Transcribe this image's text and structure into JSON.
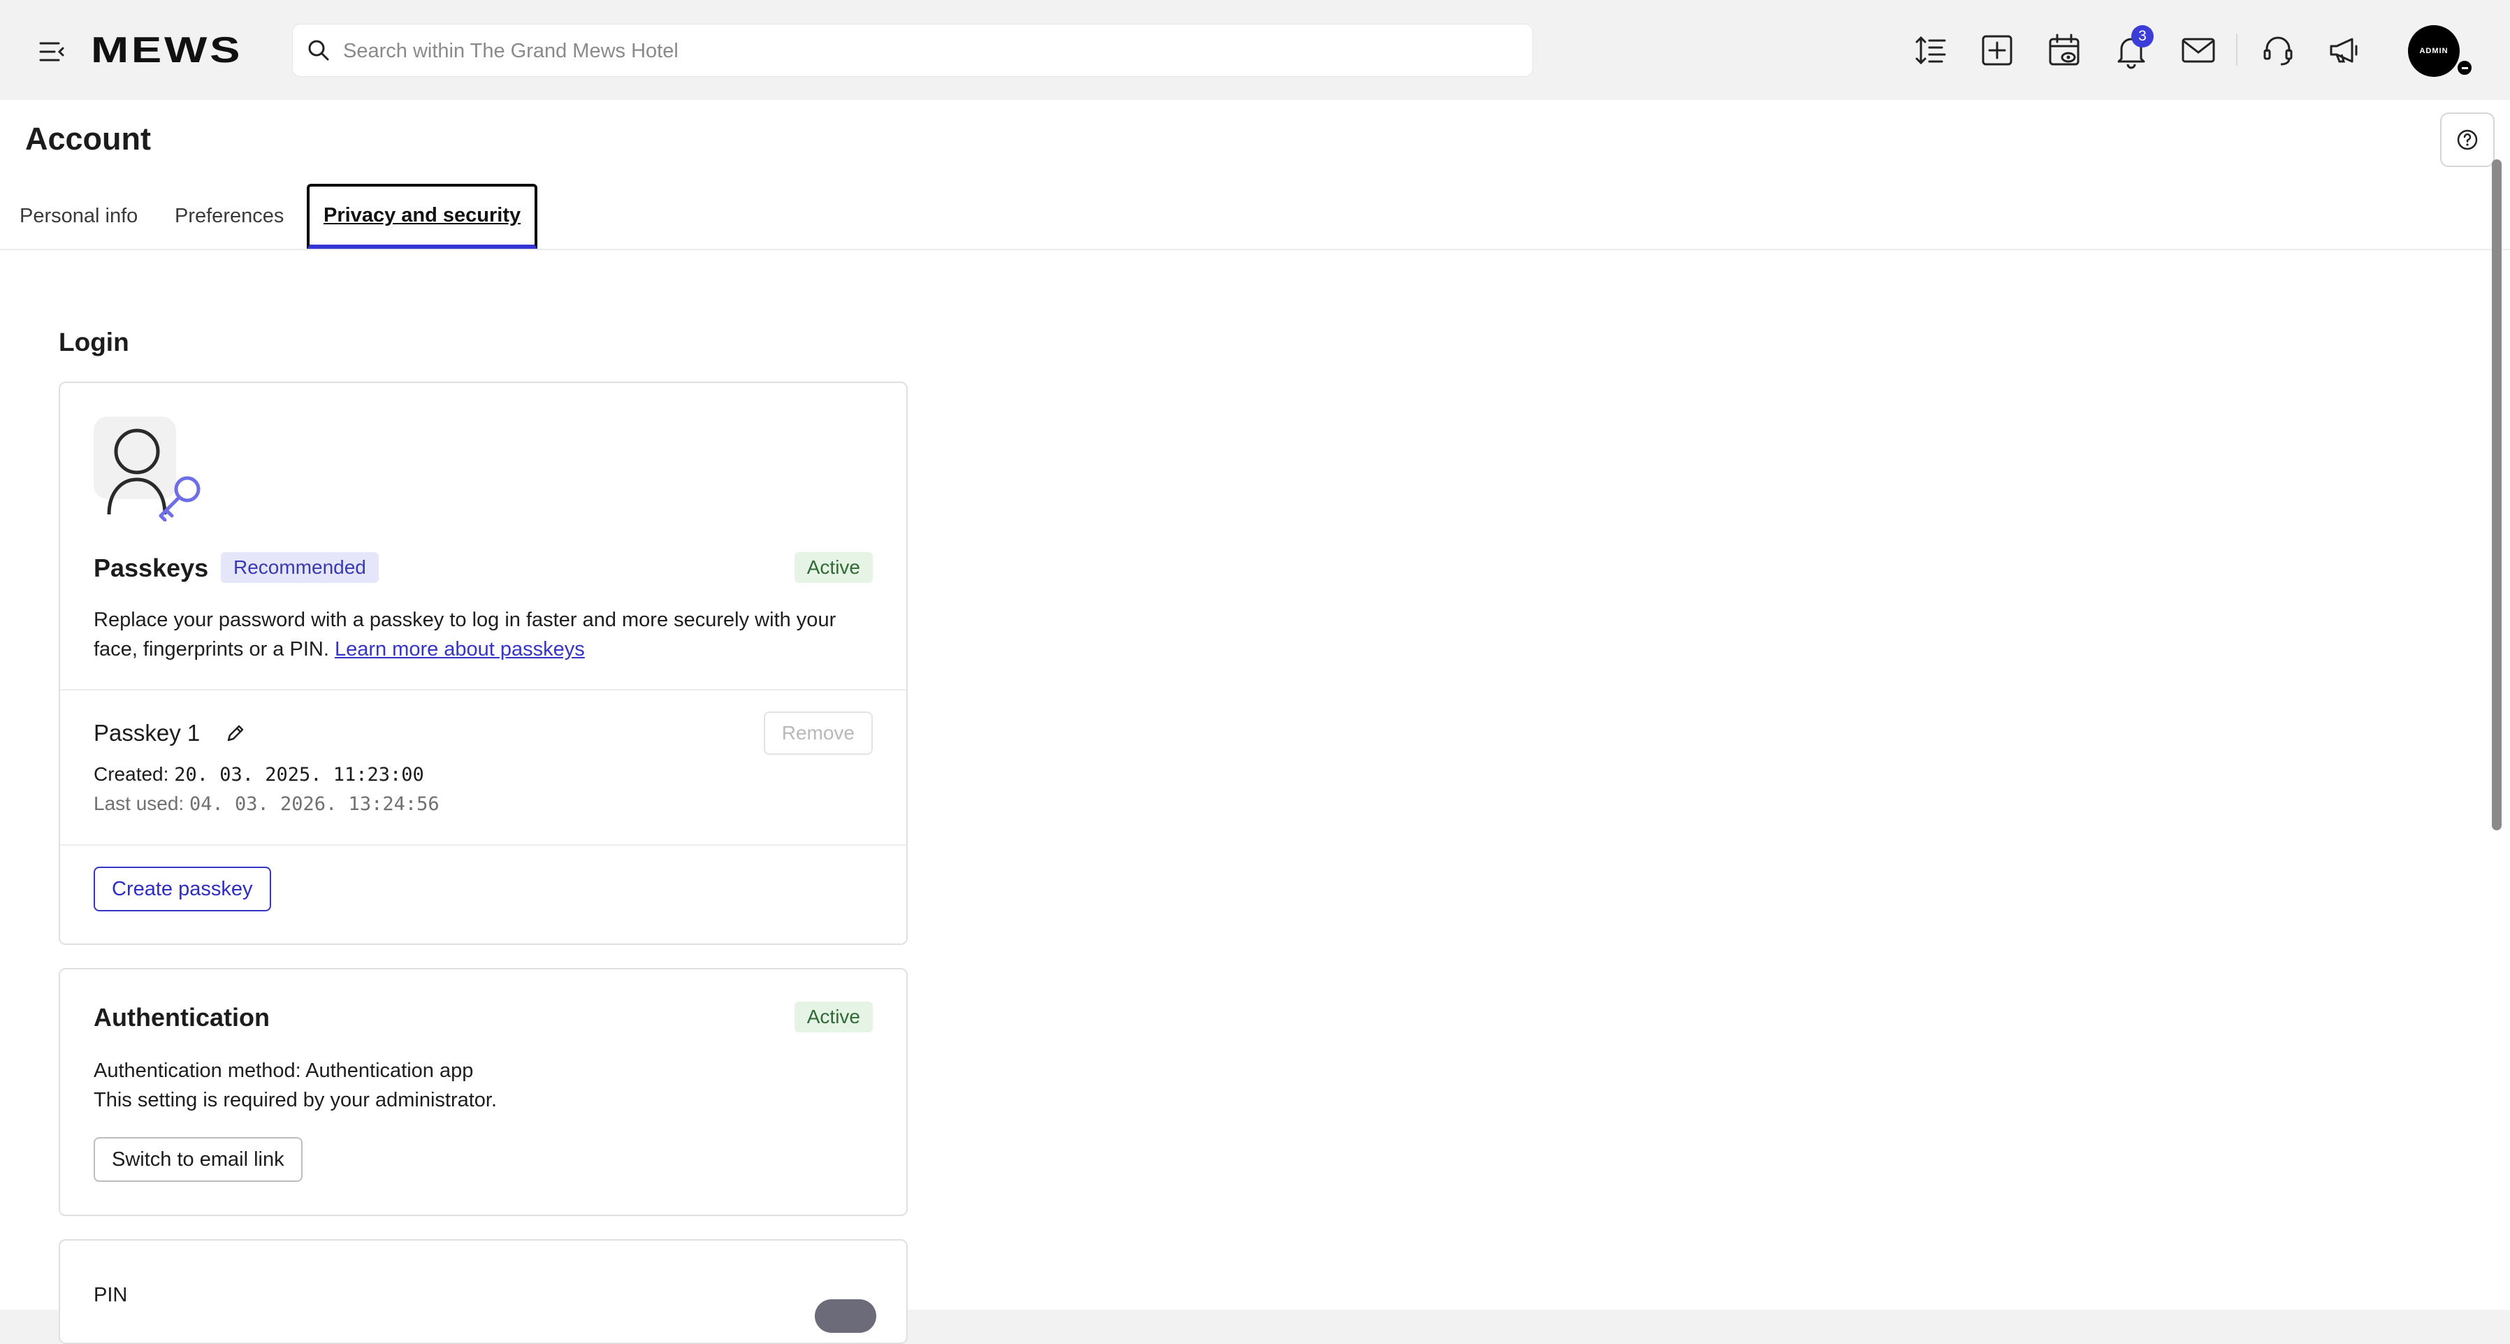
{
  "topbar": {
    "logo": "MEWS",
    "search_placeholder": "Search within The Grand Mews Hotel",
    "notification_count": "3",
    "avatar_label": "ADMIN"
  },
  "page": {
    "title": "Account",
    "tabs": [
      {
        "label": "Personal info"
      },
      {
        "label": "Preferences"
      },
      {
        "label": "Privacy and security",
        "active": true
      }
    ]
  },
  "login": {
    "section_title": "Login",
    "passkeys": {
      "title": "Passkeys",
      "recommended": "Recommended",
      "status": "Active",
      "description": "Replace your password with a passkey to log in faster and more securely with your face, fingerprints or a PIN.",
      "learn_more": "Learn more about passkeys",
      "passkey_name": "Passkey 1",
      "remove_label": "Remove",
      "created_label": "Created:",
      "created_value": "20. 03. 2025. 11:23:00",
      "last_used_label": "Last used:",
      "last_used_value": "04. 03. 2026. 13:24:56",
      "create_button": "Create passkey"
    },
    "authentication": {
      "title": "Authentication",
      "status": "Active",
      "method_line": "Authentication method: Authentication app",
      "required_line": "This setting is required by your administrator.",
      "switch_button": "Switch to email link"
    },
    "pin": {
      "title": "PIN"
    }
  },
  "colors": {
    "accent": "#3535c8",
    "active_badge_bg": "#e6f4e6",
    "recommended_badge_bg": "#e6e6fb"
  }
}
